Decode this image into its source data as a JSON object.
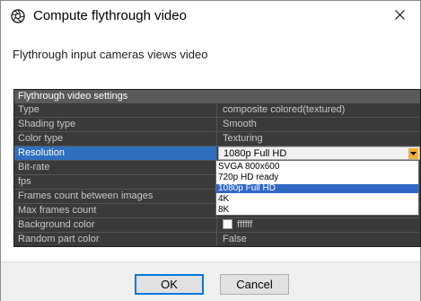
{
  "window": {
    "title": "Compute flythrough video",
    "app_icon": "aperture-icon",
    "close_icon": "close-icon"
  },
  "description": "Flythrough input cameras views video",
  "grid": {
    "header": "Flythrough video settings",
    "rows": [
      {
        "label": "Type",
        "value": "composite colored(textured)"
      },
      {
        "label": "Shading type",
        "value": "Smooth"
      },
      {
        "label": "Color type",
        "value": "Texturing"
      },
      {
        "label": "Resolution",
        "value": "1080p Full HD"
      },
      {
        "label": "Bit-rate",
        "value": ""
      },
      {
        "label": "fps",
        "value": ""
      },
      {
        "label": "Frames count between images",
        "value": ""
      },
      {
        "label": "Max frames count",
        "value": ""
      },
      {
        "label": "Background color",
        "value": "ffffff"
      },
      {
        "label": "Random part color",
        "value": "False"
      }
    ]
  },
  "resolution_dropdown": {
    "options": [
      "SVGA 800x600",
      "720p HD ready",
      "1080p Full HD",
      "4K",
      "8K"
    ],
    "selected": "1080p Full HD"
  },
  "buttons": {
    "ok": "OK",
    "cancel": "Cancel"
  },
  "colors": {
    "grid_background": "#3a3a3a",
    "selection_blue": "#2f6fbd",
    "dropdown_highlight": "#3168c6",
    "dropdown_arrow": "#f2b134",
    "default_button_border": "#0078d7",
    "background_swatch": "#ffffff"
  }
}
